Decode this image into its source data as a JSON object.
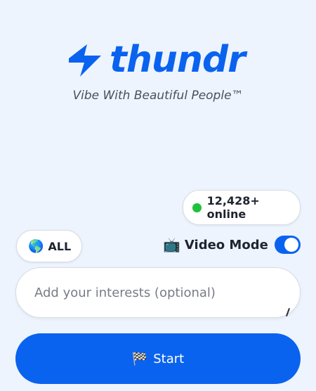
{
  "brand": {
    "name": "thundr",
    "tagline": "Vibe With Beautiful People™",
    "accent": "#0a63ef"
  },
  "online": {
    "count": "12,428+ online",
    "status_color": "#1fc23b"
  },
  "region": {
    "icon": "🌎",
    "label": "ALL"
  },
  "video_mode": {
    "icon": "📺",
    "label": "Video Mode",
    "enabled": true
  },
  "interests": {
    "placeholder": "Add your interests (optional)",
    "value": ""
  },
  "start": {
    "icon": "🏁",
    "label": "Start"
  }
}
